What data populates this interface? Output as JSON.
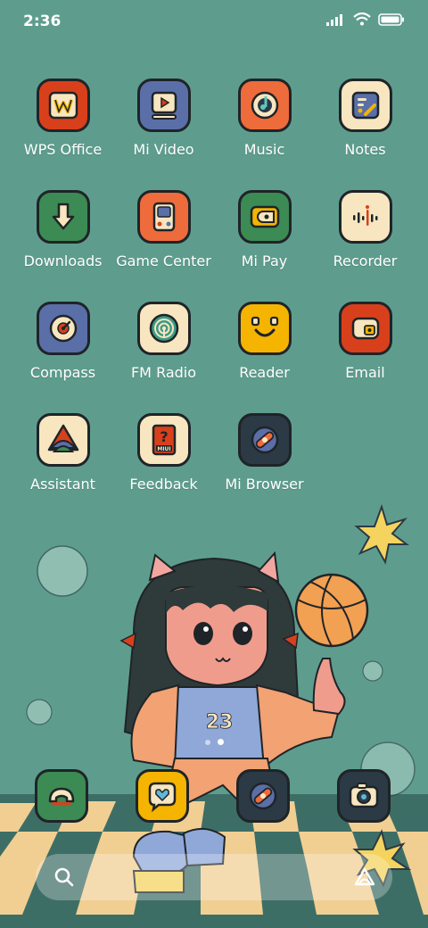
{
  "status_bar": {
    "time": "2:36"
  },
  "apps": [
    {
      "label": "WPS Office",
      "icon": "wps-office-icon",
      "bg": "#d8401c"
    },
    {
      "label": "Mi Video",
      "icon": "mi-video-icon",
      "bg": "#5a6fa8"
    },
    {
      "label": "Music",
      "icon": "music-icon",
      "bg": "#ee6b3b"
    },
    {
      "label": "Notes",
      "icon": "notes-icon",
      "bg": "#f7e6c0"
    },
    {
      "label": "Downloads",
      "icon": "downloads-icon",
      "bg": "#3c8a54"
    },
    {
      "label": "Game Center",
      "icon": "game-center-icon",
      "bg": "#ee6b3b"
    },
    {
      "label": "Mi Pay",
      "icon": "mi-pay-icon",
      "bg": "#3c8a54"
    },
    {
      "label": "Recorder",
      "icon": "recorder-icon",
      "bg": "#f7e6c0"
    },
    {
      "label": "Compass",
      "icon": "compass-icon",
      "bg": "#5a6fa8"
    },
    {
      "label": "FM Radio",
      "icon": "fm-radio-icon",
      "bg": "#f7e6c0"
    },
    {
      "label": "Reader",
      "icon": "reader-icon",
      "bg": "#f5b400"
    },
    {
      "label": "Email",
      "icon": "email-icon",
      "bg": "#d8401c"
    },
    {
      "label": "Assistant",
      "icon": "assistant-icon",
      "bg": "#f7e6c0"
    },
    {
      "label": "Feedback",
      "icon": "feedback-icon",
      "bg": "#f7e6c0"
    },
    {
      "label": "Mi Browser",
      "icon": "mi-browser-icon",
      "bg": "#2b3a45"
    }
  ],
  "feedback_badge": "MIUI",
  "jersey_number": "23",
  "dock": [
    {
      "icon": "phone-icon",
      "bg": "#3c8a54"
    },
    {
      "icon": "messages-icon",
      "bg": "#f5b400"
    },
    {
      "icon": "browser-icon",
      "bg": "#2b3a45"
    },
    {
      "icon": "camera-icon",
      "bg": "#2b3a45"
    }
  ],
  "colors": {
    "background": "#5e9d8e",
    "outline": "#1f2428",
    "cream": "#f7e6c0"
  }
}
